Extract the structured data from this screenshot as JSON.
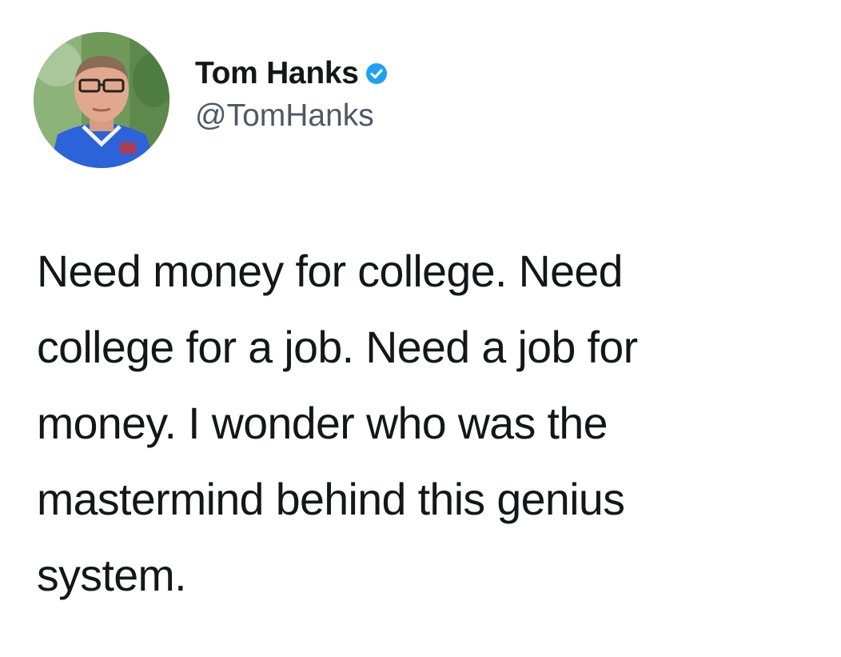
{
  "author": {
    "display_name": "Tom Hanks",
    "handle": "@TomHanks",
    "verified": true,
    "avatar_icon": "profile-photo",
    "verified_icon": "verified-badge-icon",
    "verified_color": "#1da1f2"
  },
  "tweet": {
    "lines": [
      "Need money for college. Need",
      "college for a job. Need a job for",
      "money. I wonder who was the",
      "mastermind behind this genius",
      "system."
    ]
  },
  "colors": {
    "background": "#ffffff",
    "text": "#14171a",
    "handle": "#4f5964"
  }
}
